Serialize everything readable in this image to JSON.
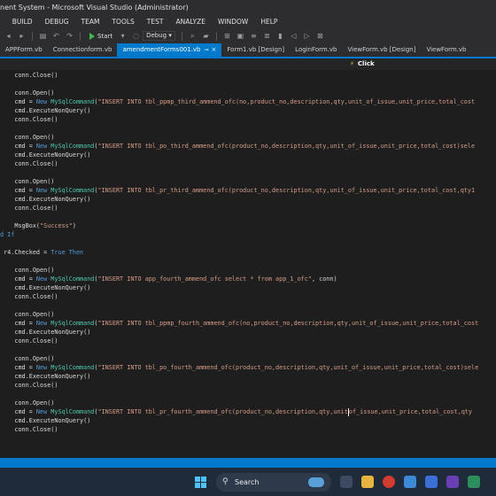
{
  "title": "nent System - Microsoft Visual Studio (Administrator)",
  "menu": [
    "E",
    "BUILD",
    "DEBUG",
    "TEAM",
    "TOOLS",
    "TEST",
    "ANALYZE",
    "WINDOW",
    "HELP"
  ],
  "toolbar": {
    "start_label": "Start",
    "config": "Debug",
    "config_arrow": "▾"
  },
  "tabs": [
    {
      "label": "APPForm.vb",
      "active": false
    },
    {
      "label": "Connectionform.vb",
      "active": false
    },
    {
      "label": "amendmentForms001.vb",
      "active": true
    },
    {
      "label": "Form1.vb [Design]",
      "active": false
    },
    {
      "label": "LoginForm.vb",
      "active": false
    },
    {
      "label": "ViewForm.vb [Design]",
      "active": false
    },
    {
      "label": "ViewForm.vb",
      "active": false
    }
  ],
  "navbar": {
    "event": "Click"
  },
  "code_lines": [
    [
      [
        "",
        "    conn.Close()"
      ]
    ],
    [],
    [
      [
        "",
        "    conn.Open()"
      ]
    ],
    [
      [
        "",
        "    cmd = "
      ],
      [
        "kw",
        "New"
      ],
      [
        "",
        " "
      ],
      [
        "ty",
        "MySqlCommand"
      ],
      [
        "",
        "("
      ],
      [
        "st",
        "\"INSERT INTO tbl_ppmp_third_ammend_ofc(no,product_no,description,qty,unit_of_issue,unit_price,total_cost"
      ]
    ],
    [
      [
        "",
        "    cmd.ExecuteNonQuery()"
      ]
    ],
    [
      [
        "",
        "    conn.Close()"
      ]
    ],
    [],
    [
      [
        "",
        "    conn.Open()"
      ]
    ],
    [
      [
        "",
        "    cmd = "
      ],
      [
        "kw",
        "New"
      ],
      [
        "",
        " "
      ],
      [
        "ty",
        "MySqlCommand"
      ],
      [
        "",
        "("
      ],
      [
        "st",
        "\"INSERT INTO tbl_po_third_ammend_ofc(product_no,description,qty,unit_of_issue,unit_price,total_cost)sele"
      ]
    ],
    [
      [
        "",
        "    cmd.ExecuteNonQuery()"
      ]
    ],
    [
      [
        "",
        "    conn.Close()"
      ]
    ],
    [],
    [
      [
        "",
        "    conn.Open()"
      ]
    ],
    [
      [
        "",
        "    cmd = "
      ],
      [
        "kw",
        "New"
      ],
      [
        "",
        " "
      ],
      [
        "ty",
        "MySqlCommand"
      ],
      [
        "",
        "("
      ],
      [
        "st",
        "\"INSERT INTO tbl_pr_third_ammend_ofc(product_no,description,qty,unit_of_issue,unit_price,total_cost,qty1"
      ]
    ],
    [
      [
        "",
        "    cmd.ExecuteNonQuery()"
      ]
    ],
    [
      [
        "",
        "    conn.Close()"
      ]
    ],
    [],
    [
      [
        "",
        "    MsgBox("
      ],
      [
        "st",
        "\"Success\""
      ],
      [
        "",
        ")"
      ]
    ],
    [
      [
        "kw",
        "d If"
      ]
    ],
    [],
    [
      [
        "",
        " r4.Checked = "
      ],
      [
        "kw",
        "True Then"
      ]
    ],
    [],
    [
      [
        "",
        "    conn.Open()"
      ]
    ],
    [
      [
        "",
        "    cmd = "
      ],
      [
        "kw",
        "New"
      ],
      [
        "",
        " "
      ],
      [
        "ty",
        "MySqlCommand"
      ],
      [
        "",
        "("
      ],
      [
        "st",
        "\"INSERT INTO app_fourth_ammend_ofc select * from app_1_ofc\""
      ],
      [
        "",
        ", conn)"
      ]
    ],
    [
      [
        "",
        "    cmd.ExecuteNonQuery()"
      ]
    ],
    [
      [
        "",
        "    conn.Close()"
      ]
    ],
    [],
    [
      [
        "",
        "    conn.Open()"
      ]
    ],
    [
      [
        "",
        "    cmd = "
      ],
      [
        "kw",
        "New"
      ],
      [
        "",
        " "
      ],
      [
        "ty",
        "MySqlCommand"
      ],
      [
        "",
        "("
      ],
      [
        "st",
        "\"INSERT INTO tbl_ppmp_fourth_ammend_ofc(no,product_no,description,qty,unit_of_issue,unit_price,total_cost"
      ]
    ],
    [
      [
        "",
        "    cmd.ExecuteNonQuery()"
      ]
    ],
    [
      [
        "",
        "    conn.Close()"
      ]
    ],
    [],
    [
      [
        "",
        "    conn.Open()"
      ]
    ],
    [
      [
        "",
        "    cmd = "
      ],
      [
        "kw",
        "New"
      ],
      [
        "",
        " "
      ],
      [
        "ty",
        "MySqlCommand"
      ],
      [
        "",
        "("
      ],
      [
        "st",
        "\"INSERT INTO tbl_po_fourth_ammend_ofc(product_no,description,qty,unit_of_issue,unit_price,total_cost)sele"
      ]
    ],
    [
      [
        "",
        "    cmd.ExecuteNonQuery()"
      ]
    ],
    [
      [
        "",
        "    conn.Close()"
      ]
    ],
    [],
    [
      [
        "",
        "    conn.Open()"
      ]
    ],
    [
      [
        "",
        "    cmd = "
      ],
      [
        "kw",
        "New"
      ],
      [
        "",
        " "
      ],
      [
        "ty",
        "MySqlCommand"
      ],
      [
        "",
        "("
      ],
      [
        "st",
        "\"INSERT INTO tbl_pr_fourth_ammend_ofc(product_no,description,qty,unit"
      ],
      [
        "cursor",
        ""
      ],
      [
        "st",
        "of_issue,unit_price,total_cost,qty"
      ]
    ],
    [
      [
        "",
        "    cmd.ExecuteNonQuery()"
      ]
    ],
    [
      [
        "",
        "    conn.Close()"
      ]
    ]
  ],
  "taskbar": {
    "search_placeholder": "Search"
  }
}
